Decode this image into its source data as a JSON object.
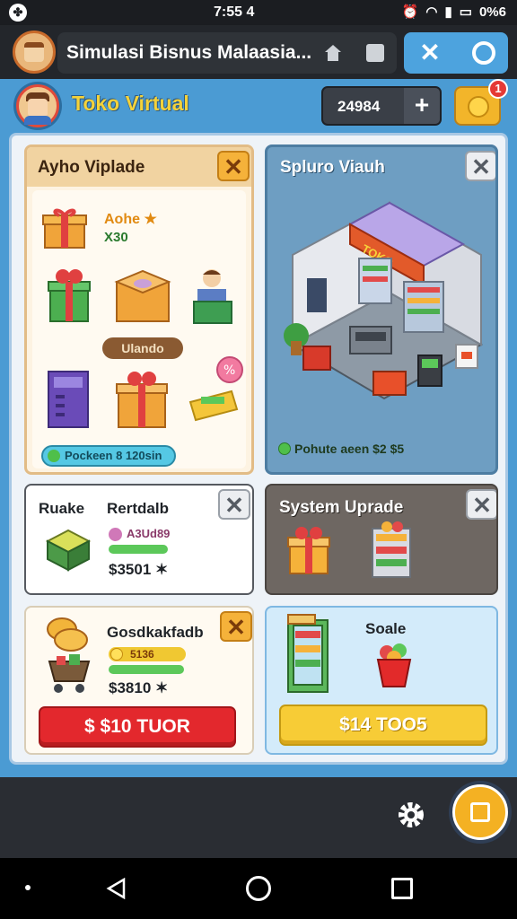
{
  "status_bar": {
    "time": "7:55 4",
    "battery": "0%6"
  },
  "browser": {
    "title": "Simulasi Bisnus Malaasia..."
  },
  "game": {
    "shop_title": "Toko Virtual",
    "coins": "24984",
    "notification_count": "1"
  },
  "cards": {
    "upgrade": {
      "title": "Ayho Viplade",
      "item_name": "Aohe ★",
      "item_qty": "X30",
      "category": "Ulando",
      "progress_label": "Pockeen 8 120sin"
    },
    "store_view": {
      "title": "Spluro Viauh",
      "stat": "Pohute aeen $2 $5"
    },
    "rentals": {
      "title_left": "Ruake",
      "title_right": "Rertdalb",
      "tag": "A3Ud89",
      "price": "$3501 ✶"
    },
    "system_upgrade": {
      "title": "System Uprade"
    },
    "goods": {
      "title": "Gosdkakfadb",
      "tag": "5136",
      "price": "$3810 ✶",
      "buy_label": "$ $10 TUOR"
    },
    "scale": {
      "title": "Soale",
      "buy_label": "$14 TOO5"
    }
  },
  "colors": {
    "game_blue": "#4b9bd3",
    "accent_orange": "#f5b23a",
    "buy_red": "#e3282d",
    "buy_yellow": "#f7cc36"
  }
}
